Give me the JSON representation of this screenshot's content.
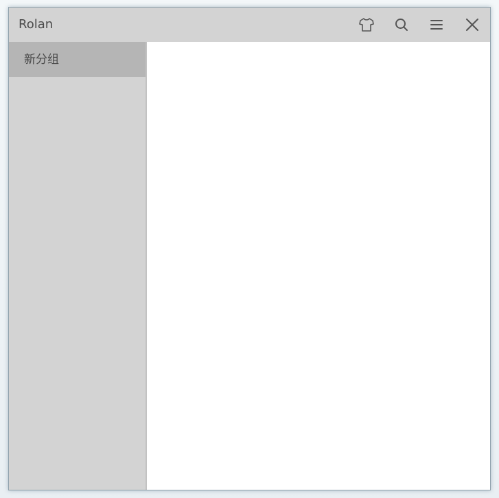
{
  "window": {
    "title": "Rolan"
  },
  "toolbar": {
    "buttons": [
      {
        "icon": "shirt-icon",
        "action": "skin"
      },
      {
        "icon": "search-icon",
        "action": "search"
      },
      {
        "icon": "menu-icon",
        "action": "menu"
      },
      {
        "icon": "close-icon",
        "action": "close"
      }
    ]
  },
  "sidebar": {
    "groups": [
      {
        "label": "新分组",
        "selected": true
      }
    ]
  },
  "colors": {
    "titlebar_bg": "#d3d3d3",
    "sidebar_bg": "#d3d3d3",
    "selected_group_bg": "#b5b5b5",
    "content_bg": "#ffffff",
    "icon_color": "#555555",
    "text_color": "#4a4a4a"
  }
}
